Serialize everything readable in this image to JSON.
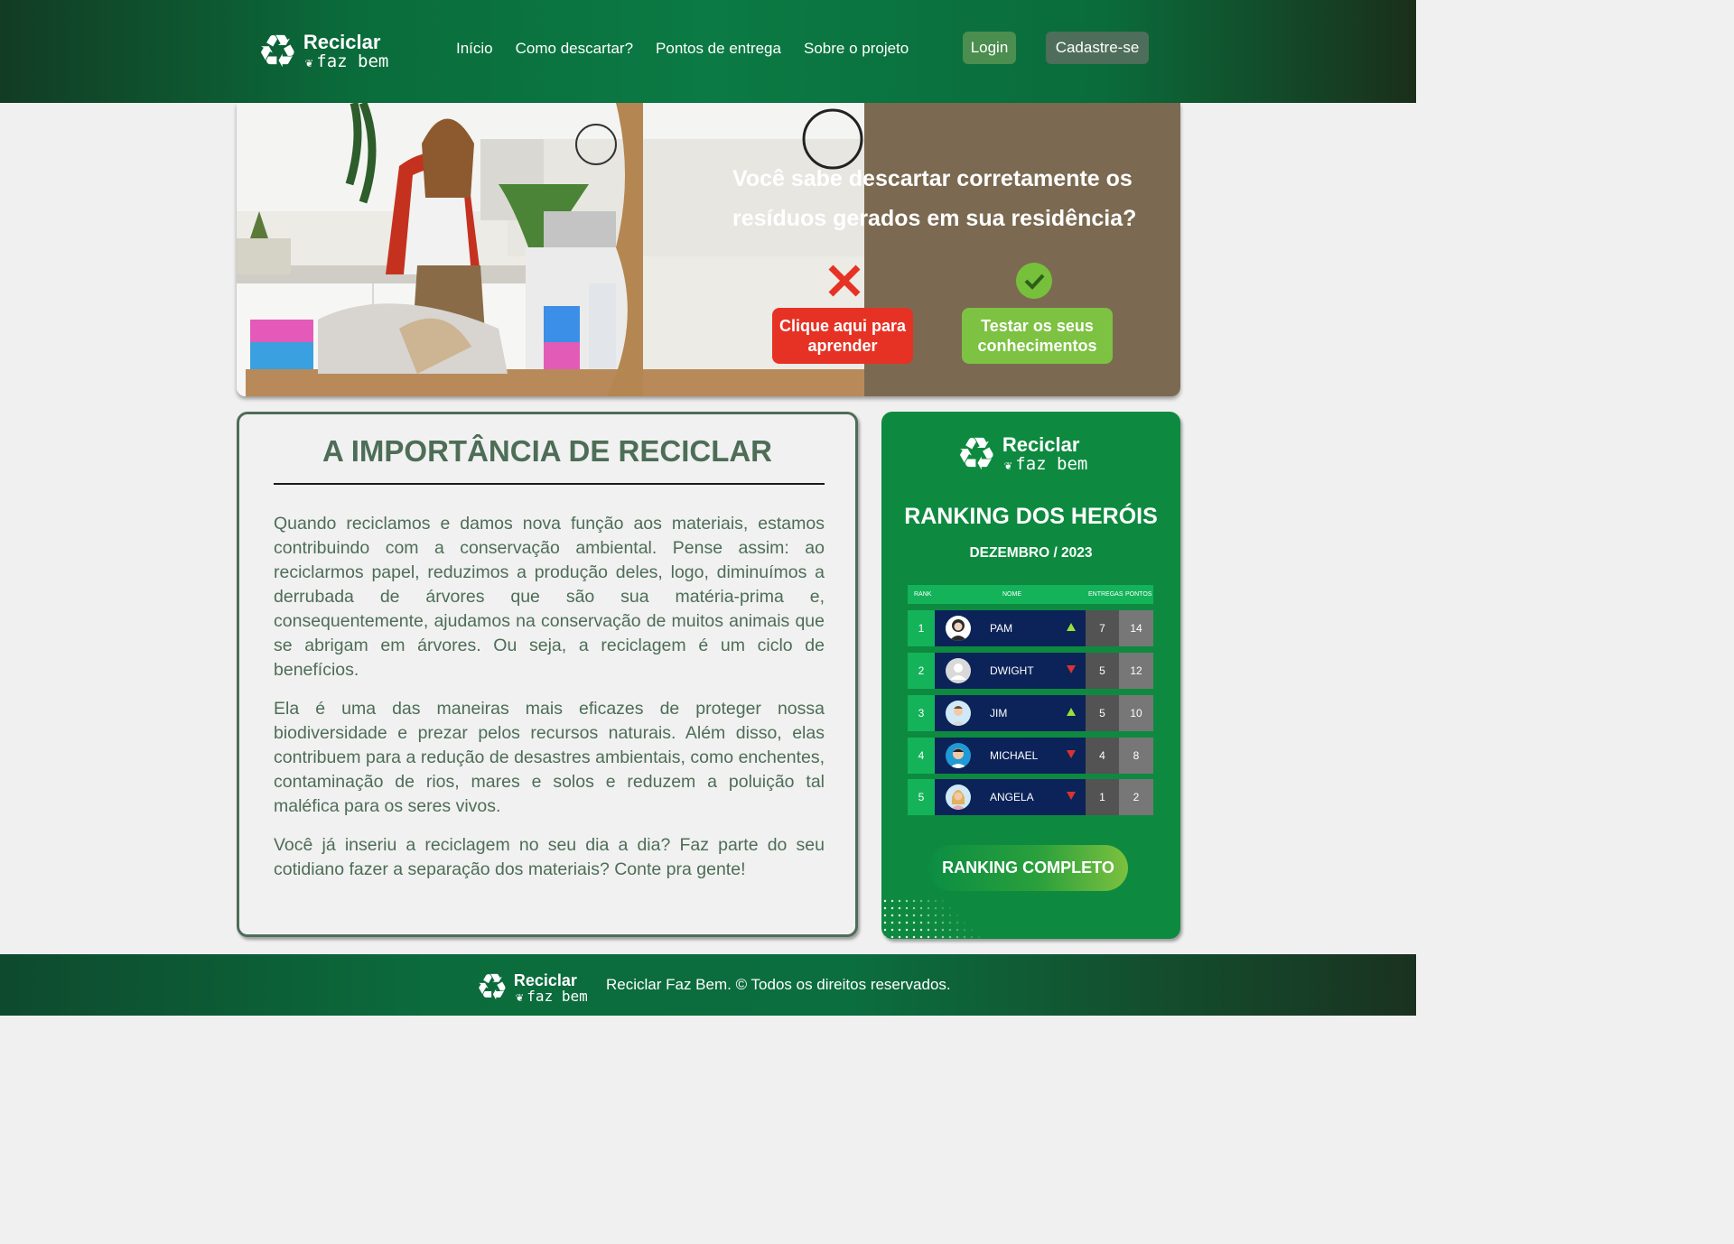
{
  "brand": {
    "name_line1": "Reciclar",
    "name_line2": "faz bem",
    "logo_icon": "recycle-icon"
  },
  "nav": {
    "items": [
      "Início",
      "Como descartar?",
      "Pontos de entrega",
      "Sobre o projeto"
    ]
  },
  "auth": {
    "login": "Login",
    "signup": "Cadastre-se"
  },
  "hero": {
    "question": "Você sabe descartar corretamente os resíduos gerados em sua residência?",
    "learn_button": "Clique aqui para aprender",
    "test_button": "Testar os seus conhecimentos",
    "colors": {
      "wrong": "#e63225",
      "right": "#7dc242"
    }
  },
  "article": {
    "title": "A IMPORTÂNCIA DE RECICLAR",
    "paragraphs": [
      "Quando reciclamos e damos nova função aos materiais, estamos contribuindo com a conservação ambiental. Pense assim: ao reciclarmos papel, reduzimos a produção deles, logo, diminuímos a derrubada de árvores que são sua matéria-prima e, consequentemente, ajudamos na conservação de muitos animais que se abrigam em árvores. Ou seja, a reciclagem é um ciclo de benefícios.",
      "Ela é uma das maneiras mais eficazes de proteger nossa biodiversidade e prezar pelos recursos naturais. Além disso, elas contribuem para a redução de desastres ambientais, como enchentes, contaminação de rios, mares e solos e reduzem a poluição tal maléfica para os seres vivos.",
      "Você já inseriu a reciclagem no seu dia a dia? Faz parte do seu cotidiano fazer a separação dos materiais? Conte pra gente!"
    ]
  },
  "ranking": {
    "title": "RANKING DOS HERÓIS",
    "period": "DEZEMBRO / 2023",
    "headers": {
      "rank": "RANK",
      "name": "NOME",
      "deliveries": "ENTREGAS",
      "points": "PONTOS"
    },
    "rows": [
      {
        "rank": "1",
        "name": "PAM",
        "trend": "up",
        "deliveries": "7",
        "points": "14"
      },
      {
        "rank": "2",
        "name": "DWIGHT",
        "trend": "down",
        "deliveries": "5",
        "points": "12"
      },
      {
        "rank": "3",
        "name": "JIM",
        "trend": "up",
        "deliveries": "5",
        "points": "10"
      },
      {
        "rank": "4",
        "name": "MICHAEL",
        "trend": "down",
        "deliveries": "4",
        "points": "8"
      },
      {
        "rank": "5",
        "name": "ANGELA",
        "trend": "down",
        "deliveries": "1",
        "points": "2"
      }
    ],
    "button": "RANKING COMPLETO"
  },
  "footer": {
    "copyright": "Reciclar Faz Bem. © Todos os direitos reservados."
  }
}
